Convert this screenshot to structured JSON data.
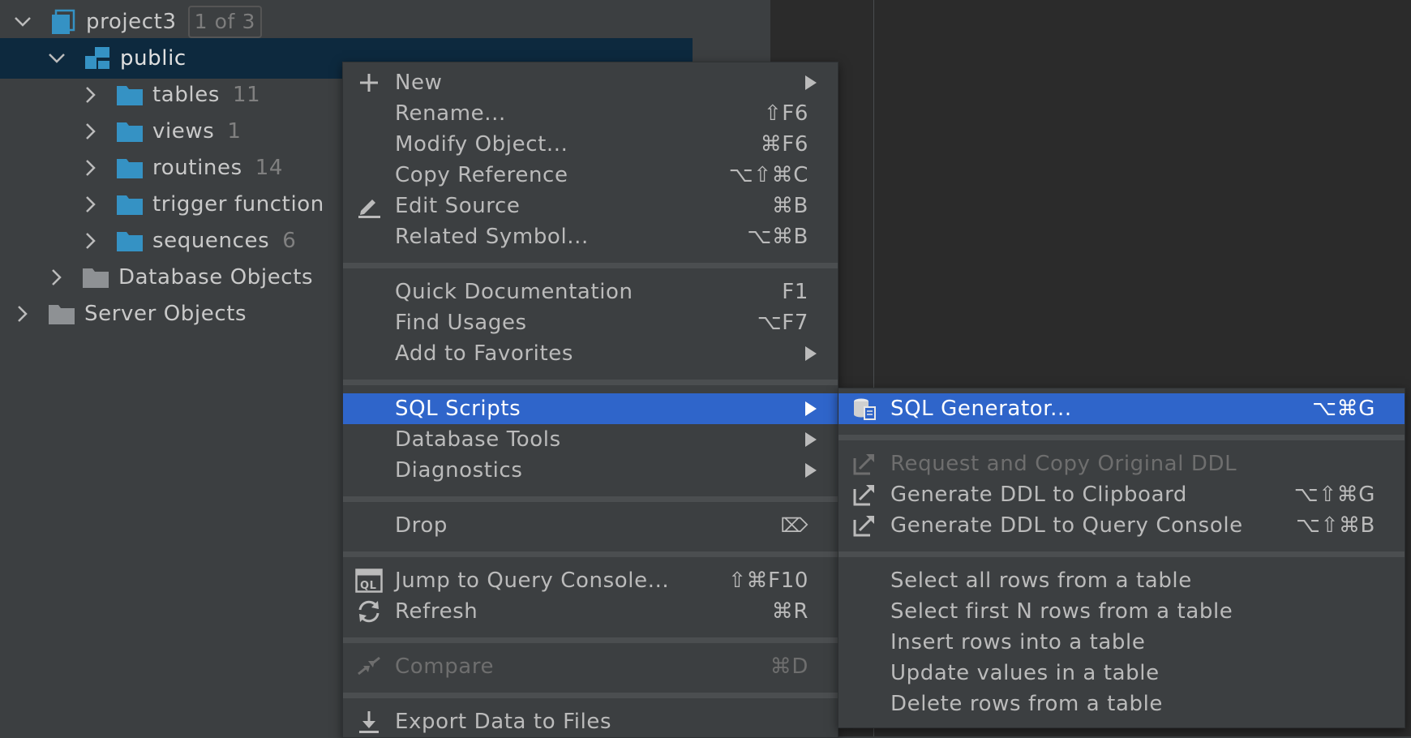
{
  "tree": {
    "project": {
      "label": "project3",
      "badge": "1 of 3"
    },
    "schema": {
      "label": "public"
    },
    "folders": [
      {
        "label": "tables",
        "count": "11"
      },
      {
        "label": "views",
        "count": "1"
      },
      {
        "label": "routines",
        "count": "14"
      },
      {
        "label": "trigger function",
        "count": ""
      },
      {
        "label": "sequences",
        "count": "6"
      }
    ],
    "database_objects": {
      "label": "Database Objects"
    },
    "server_objects": {
      "label": "Server Objects"
    }
  },
  "context_menu": {
    "items": [
      {
        "label": "New",
        "shortcut": "",
        "icon": "plus-icon",
        "submenu": true
      },
      {
        "label": "Rename...",
        "shortcut": "⇧F6"
      },
      {
        "label": "Modify Object...",
        "shortcut": "⌘F6"
      },
      {
        "label": "Copy Reference",
        "shortcut": "⌥⇧⌘C"
      },
      {
        "label": "Edit Source",
        "shortcut": "⌘B",
        "icon": "pencil-icon"
      },
      {
        "label": "Related Symbol...",
        "shortcut": "⌥⌘B"
      },
      {
        "label": "Quick Documentation",
        "shortcut": "F1"
      },
      {
        "label": "Find Usages",
        "shortcut": "⌥F7"
      },
      {
        "label": "Add to Favorites",
        "shortcut": "",
        "submenu": true
      },
      {
        "label": "SQL Scripts",
        "shortcut": "",
        "submenu": true,
        "highlighted": true
      },
      {
        "label": "Database Tools",
        "shortcut": "",
        "submenu": true
      },
      {
        "label": "Diagnostics",
        "shortcut": "",
        "submenu": true
      },
      {
        "label": "Drop",
        "shortcut": "⌦"
      },
      {
        "label": "Jump to Query Console...",
        "shortcut": "⇧⌘F10",
        "icon": "ql-icon"
      },
      {
        "label": "Refresh",
        "shortcut": "⌘R",
        "icon": "refresh-icon"
      },
      {
        "label": "Compare",
        "shortcut": "⌘D",
        "icon": "compare-icon",
        "disabled": true
      },
      {
        "label": "Export Data to Files",
        "shortcut": "",
        "icon": "download-icon"
      }
    ]
  },
  "sql_scripts_submenu": {
    "items": [
      {
        "label": "SQL Generator...",
        "shortcut": "⌥⌘G",
        "icon": "sql-generator-icon",
        "highlighted": true
      },
      {
        "label": "Request and Copy Original DDL",
        "shortcut": "",
        "icon": "export-icon",
        "disabled": true
      },
      {
        "label": "Generate DDL to Clipboard",
        "shortcut": "⌥⇧⌘G",
        "icon": "export-icon"
      },
      {
        "label": "Generate DDL to Query Console",
        "shortcut": "⌥⇧⌘B",
        "icon": "export-icon"
      },
      {
        "label": "Select all rows from a table",
        "shortcut": ""
      },
      {
        "label": "Select first N rows from a table",
        "shortcut": ""
      },
      {
        "label": "Insert rows into a table",
        "shortcut": ""
      },
      {
        "label": "Update values in a table",
        "shortcut": ""
      },
      {
        "label": "Delete rows from a table",
        "shortcut": ""
      }
    ]
  },
  "colors": {
    "background": "#3c3f41",
    "selection": "#2f65ca",
    "tree_selection": "#0d293e",
    "folder": "#3592c4"
  }
}
